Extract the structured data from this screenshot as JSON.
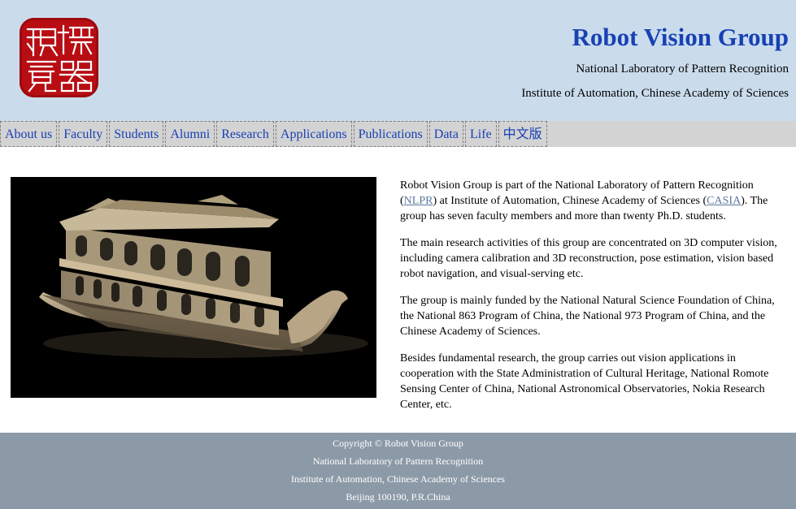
{
  "header": {
    "logo_chars": [
      "機",
      "器",
      "視",
      "覺"
    ],
    "title": "Robot Vision Group",
    "subtitle_1": "National Laboratory of Pattern Recognition",
    "subtitle_2": "Institute of Automation, Chinese Academy of Sciences"
  },
  "nav": {
    "items": [
      "About us",
      "Faculty",
      "Students",
      "Alumni",
      "Research",
      "Applications",
      "Publications",
      "Data",
      "Life",
      "中文版"
    ]
  },
  "main": {
    "p1_before_nlpr": "Robot Vision Group is part of the National Laboratory of Pattern Recognition (",
    "nlpr_link": "NLPR",
    "p1_mid": ") at Institute of Automation, Chinese Academy of Sciences (",
    "casia_link": "CASIA",
    "p1_after": "). The group has seven faculty members and more than twenty Ph.D. students.",
    "p2": "The main research activities of this group are concentrated on 3D computer vision, including camera calibration and 3D reconstruction, pose estimation, vision based robot navigation, and visual-serving etc.",
    "p3": "The group is mainly funded by the National Natural Science Foundation of China, the National 863 Program of China, the National 973 Program of China, and the Chinese Academy of Sciences.",
    "p4": "Besides fundamental research, the group carries out vision applications in cooperation with the State Administration of Cultural Heritage, National Romote Sensing Center of China, National Astronomical Observatories, Nokia Research Center, etc."
  },
  "footer": {
    "line1": "Copyright © Robot Vision Group",
    "line2": "National Laboratory of Pattern Recognition",
    "line3": "Institute of Automation, Chinese Academy of Sciences",
    "line4": "Beijing 100190, P.R.China"
  },
  "colors": {
    "header_bg": "#cadcec",
    "title_blue": "#1841b4",
    "nav_bg": "#d3d3d3",
    "logo_red": "#b80d13",
    "footer_bg": "#8c9aa8"
  }
}
